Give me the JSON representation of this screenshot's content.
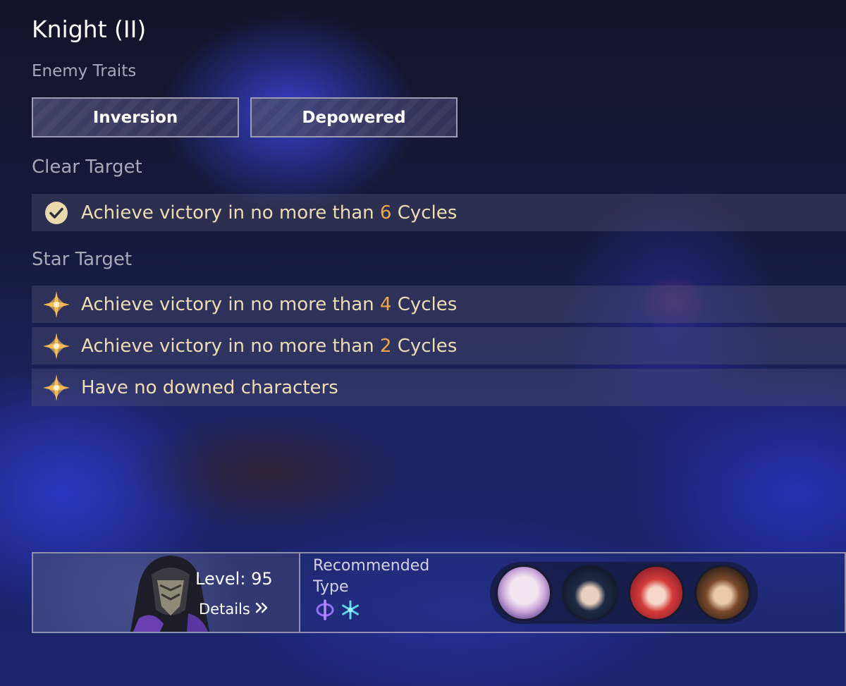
{
  "title": "Knight (II)",
  "enemy_traits": {
    "label": "Enemy Traits",
    "items": [
      {
        "label": "Inversion"
      },
      {
        "label": "Depowered"
      }
    ]
  },
  "clear_target": {
    "label": "Clear Target",
    "item": {
      "prefix": "Achieve victory in no more than ",
      "number": "6",
      "suffix": " Cycles"
    }
  },
  "star_target": {
    "label": "Star Target",
    "items": [
      {
        "prefix": "Achieve victory in no more than ",
        "number": "4",
        "suffix": " Cycles"
      },
      {
        "prefix": "Achieve victory in no more than ",
        "number": "2",
        "suffix": " Cycles"
      },
      {
        "prefix": "Have no downed characters",
        "number": "",
        "suffix": ""
      }
    ]
  },
  "enemy": {
    "level": "Level: 95",
    "details": "Details"
  },
  "recommended": {
    "label": "Recommended Type",
    "types": [
      "imaginary-icon",
      "ice-icon"
    ]
  },
  "recommended_characters": [
    "character-avatar-1",
    "character-avatar-2",
    "character-avatar-3",
    "character-avatar-4"
  ],
  "colors": {
    "accent_number": "#f2a64a",
    "target_text": "#eddcb4",
    "star": "#f5b24a",
    "imaginary": "#9b6bff",
    "ice": "#5fd6e8"
  }
}
